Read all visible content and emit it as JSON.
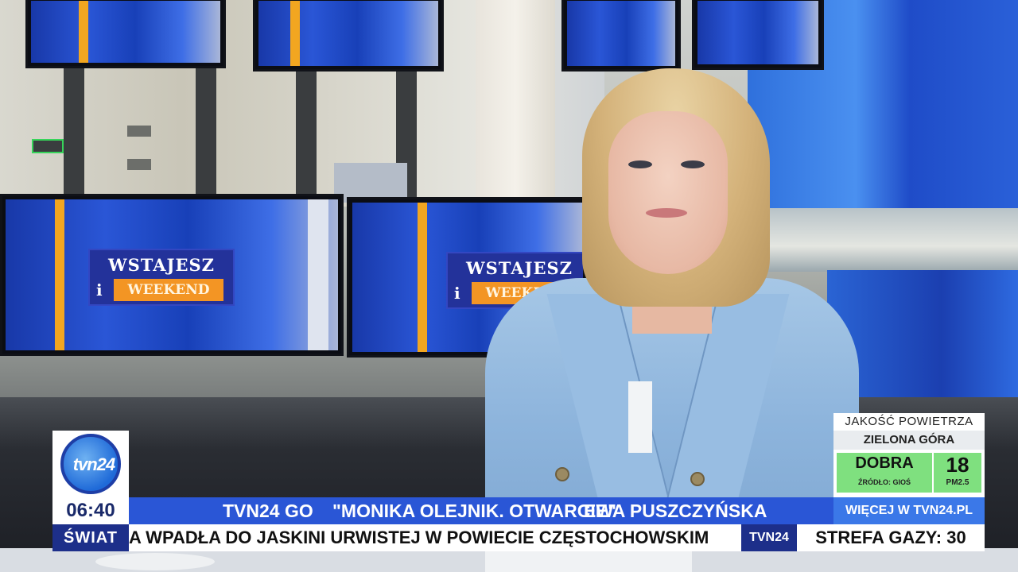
{
  "background": {
    "monitor_logo": {
      "line1": "WSTAJESZ",
      "line2_prefix": "i",
      "line2": "WEEKEND"
    }
  },
  "graphics": {
    "channel_logo": {
      "text": "tvn24",
      "icon": "tvn24-logo-icon"
    },
    "clock": "06:40",
    "headline_bar": {
      "items": [
        "TVN24 GO",
        "\"MONIKA OLEJNIK. OTWARCIE\"",
        "EWA PUSZCZYŃSKA"
      ]
    },
    "more_link": "WIĘCEJ W TVN24.PL",
    "ticker": {
      "category": "ŚWIAT",
      "text": "A WPADŁA DO JASKINI URWISTEJ W POWIECIE CZĘSTOCHOWSKIM",
      "brand": "TVN24",
      "right_text": "STREFA GAZY: 30"
    },
    "air_quality": {
      "title": "JAKOŚĆ POWIETRZA",
      "city": "ZIELONA GÓRA",
      "status": "DOBRA",
      "source": "ŹRÓDŁO: GIOŚ",
      "value": "18",
      "unit": "PM2.5",
      "status_color": "#7fe07f"
    }
  },
  "colors": {
    "brand_blue": "#2a56d6",
    "brand_dark": "#1d2f8a",
    "accent_orange": "#f39524"
  }
}
